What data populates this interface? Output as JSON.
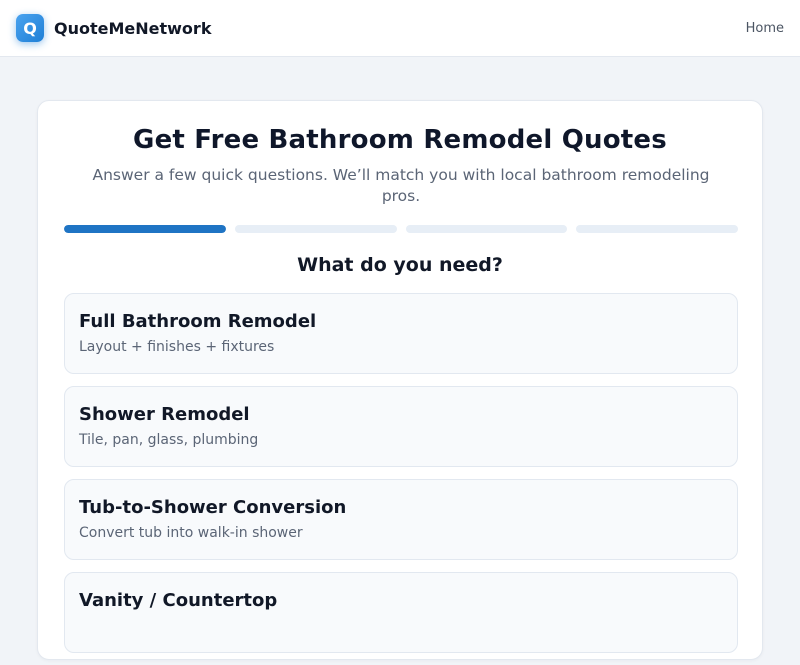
{
  "header": {
    "logo_letter": "Q",
    "brand": "QuoteMeNetwork",
    "nav_home": "Home"
  },
  "form": {
    "title": "Get Free Bathroom Remodel Quotes",
    "subtitle": "Answer a few quick questions. We’ll match you with local bathroom remodeling pros.",
    "progress": {
      "current_step": 1,
      "total_steps": 4,
      "accent": "#1f74c4",
      "track": "#e7eef6"
    },
    "question": "What do you need?",
    "options": [
      {
        "title": "Full Bathroom Remodel",
        "desc": "Layout + finishes + fixtures"
      },
      {
        "title": "Shower Remodel",
        "desc": "Tile, pan, glass, plumbing"
      },
      {
        "title": "Tub-to-Shower Conversion",
        "desc": "Convert tub into walk-in shower"
      },
      {
        "title": "Vanity / Countertop",
        "desc": ""
      }
    ]
  },
  "colors": {
    "brand": "#1f7fd6",
    "background": "#f1f4f8"
  }
}
